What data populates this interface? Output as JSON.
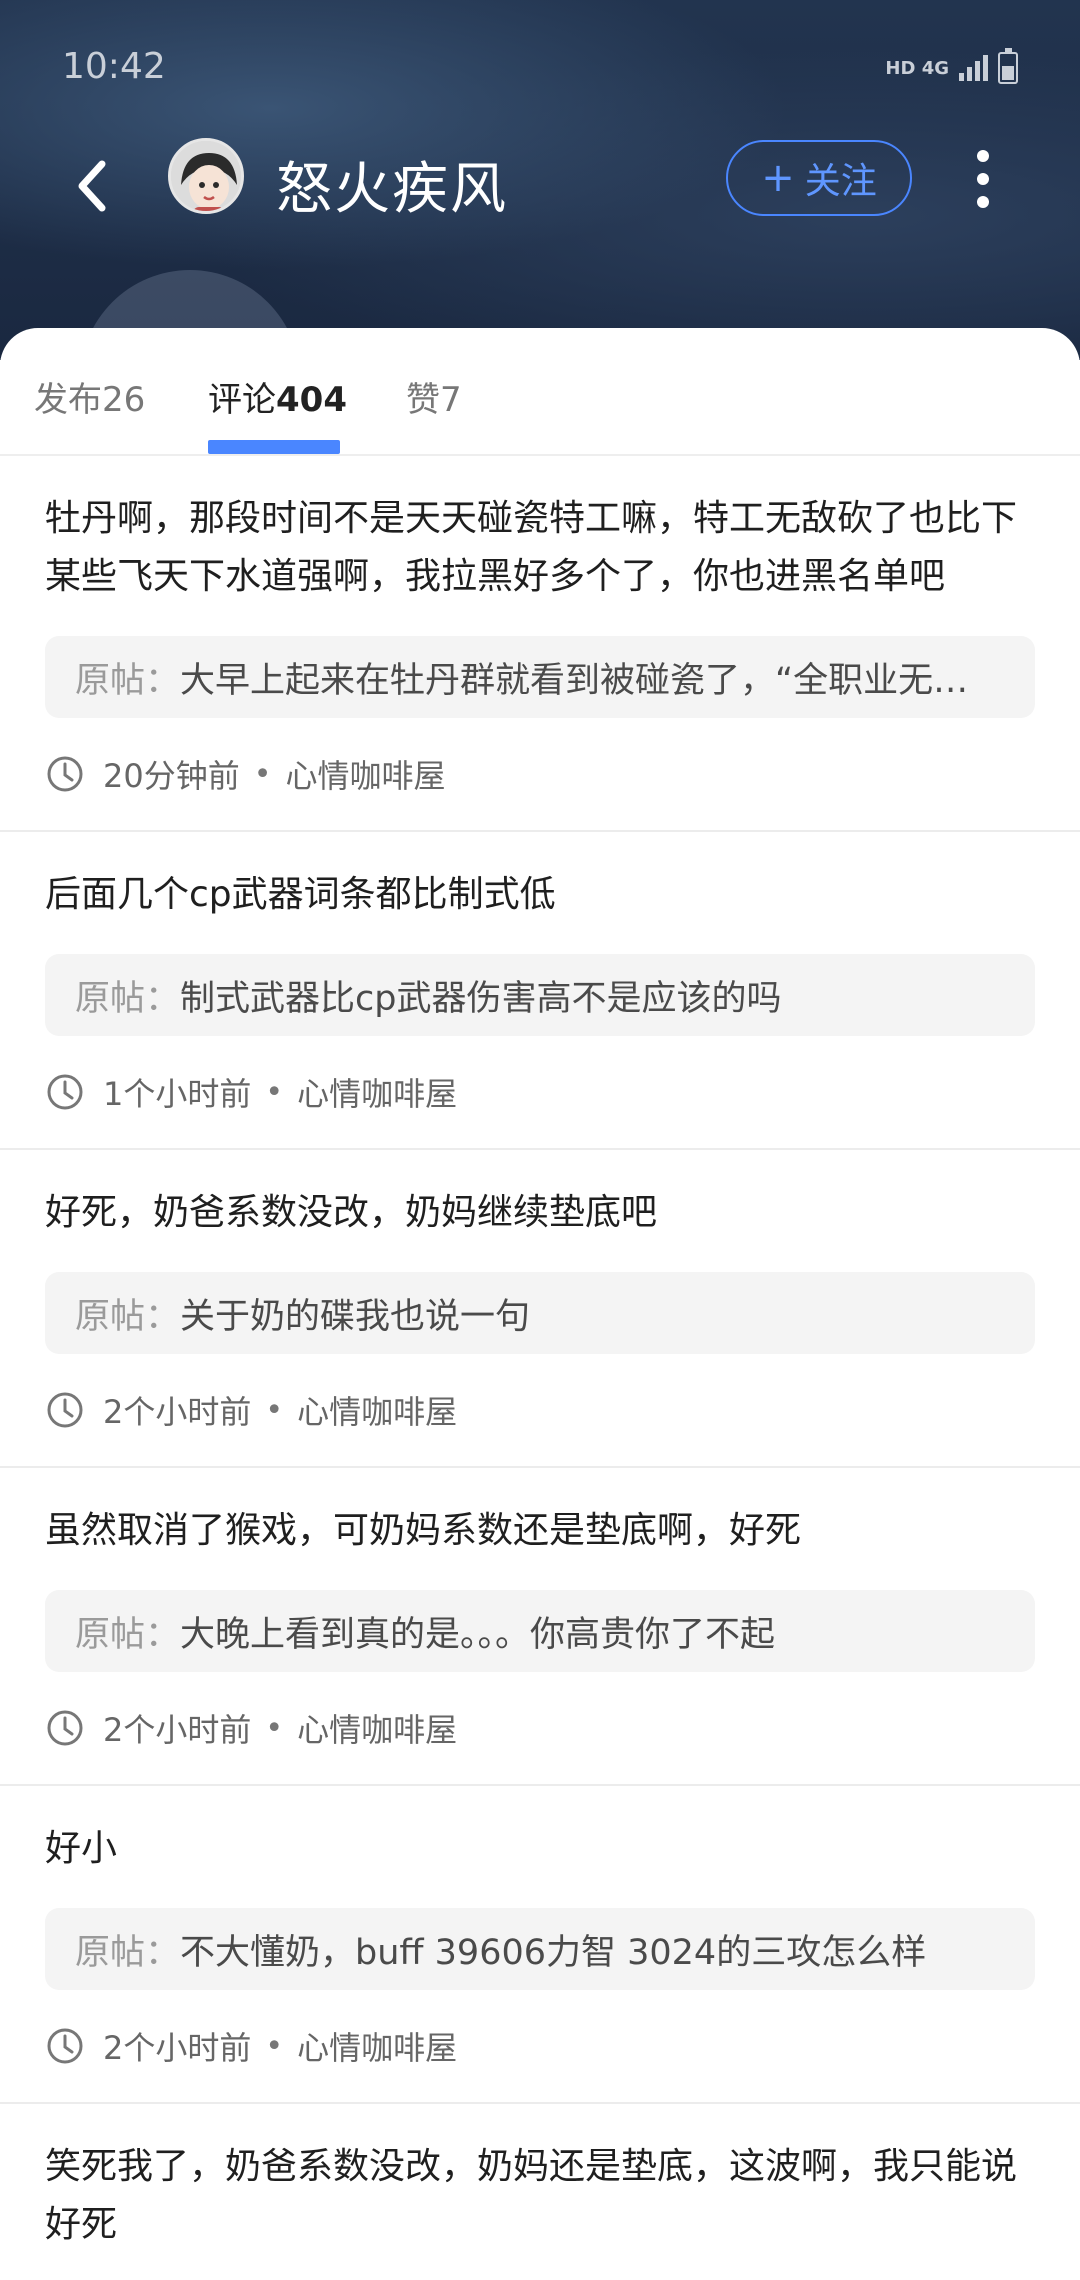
{
  "status_bar": {
    "time": "10:42",
    "network": "HD 4G"
  },
  "header": {
    "username": "怒火疾风",
    "follow_label": "关注"
  },
  "tabs": [
    {
      "label": "发布",
      "count": "26",
      "active": false
    },
    {
      "label": "评论",
      "count": "404",
      "active": true
    },
    {
      "label": "赞",
      "count": "7",
      "active": false
    }
  ],
  "comments": [
    {
      "text": "牡丹啊，那段时间不是天天碰瓷特工嘛，特工无敌砍了也比下某些飞天下水道强啊，我拉黑好多个了，你也进黑名单吧",
      "origin_label": "原帖：",
      "origin_text": "大早上起来在牡丹群就看到被碰瓷了，“全职业无…",
      "time": "20分钟前",
      "channel": "心情咖啡屋"
    },
    {
      "text": "后面几个cp武器词条都比制式低",
      "origin_label": "原帖：",
      "origin_text": "制式武器比cp武器伤害高不是应该的吗",
      "time": "1个小时前",
      "channel": "心情咖啡屋"
    },
    {
      "text": "好死，奶爸系数没改，奶妈继续垫底吧",
      "origin_label": "原帖：",
      "origin_text": "关于奶的碟我也说一句",
      "time": "2个小时前",
      "channel": "心情咖啡屋"
    },
    {
      "text": "虽然取消了猴戏，可奶妈系数还是垫底啊，好死",
      "origin_label": "原帖：",
      "origin_text": "大晚上看到真的是。。。你高贵你了不起",
      "time": "2个小时前",
      "channel": "心情咖啡屋"
    },
    {
      "text": "好小",
      "origin_label": "原帖：",
      "origin_text": "不大懂奶，buff 39606力智 3024的三攻怎么样",
      "time": "2个小时前",
      "channel": "心情咖啡屋"
    },
    {
      "text": "笑死我了，奶爸系数没改，奶妈还是垫底，这波啊，我只能说好死"
    }
  ],
  "colors": {
    "accent": "#4a86ff",
    "header_bg": "#1f2f48"
  }
}
